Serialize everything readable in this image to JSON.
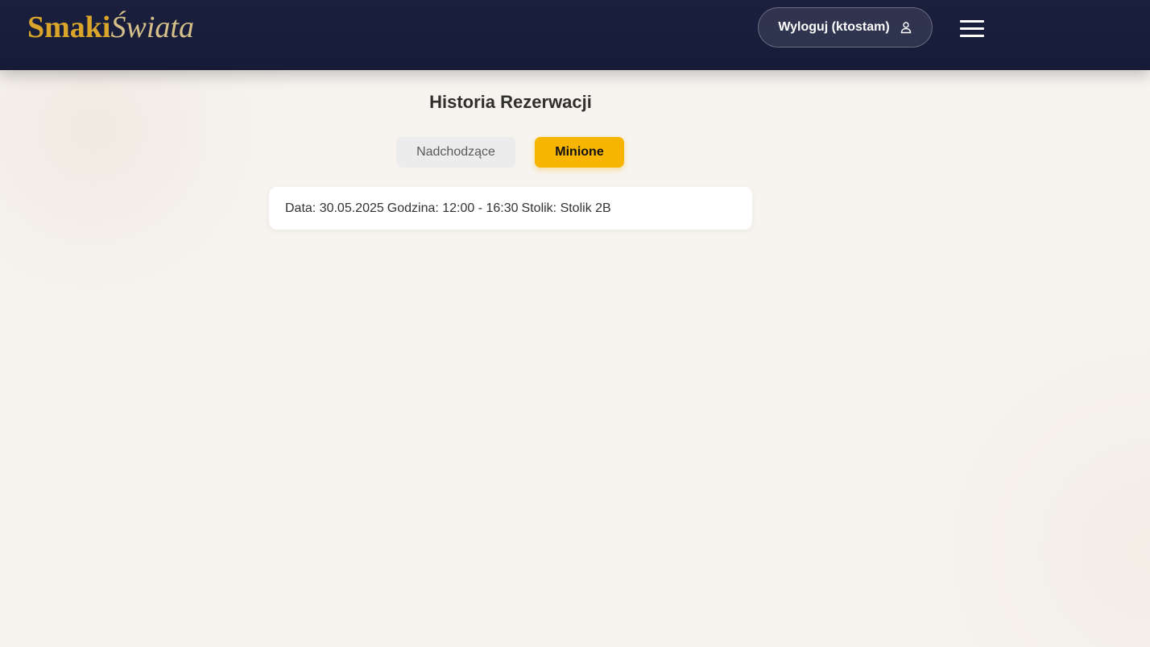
{
  "header": {
    "logo": {
      "part1": "Smaki",
      "part2": "Świata"
    },
    "logout_label": "Wyloguj (ktostam)",
    "user_icon": "user-icon",
    "menu_icon": "hamburger-menu-icon"
  },
  "main": {
    "title": "Historia Rezerwacji",
    "tabs": [
      {
        "label": "Nadchodzące",
        "active": false
      },
      {
        "label": "Minione",
        "active": true
      }
    ],
    "reservations": [
      {
        "date": "Data: 30.05.2025",
        "time": "Godzina: 12:00 - 16:30",
        "table": "Stolik: Stolik 2B"
      }
    ]
  },
  "colors": {
    "navbar": "#1a1f3d",
    "brand_gold": "#d9a52a",
    "accent": "#f7b500",
    "background": "#f7f4f0"
  }
}
